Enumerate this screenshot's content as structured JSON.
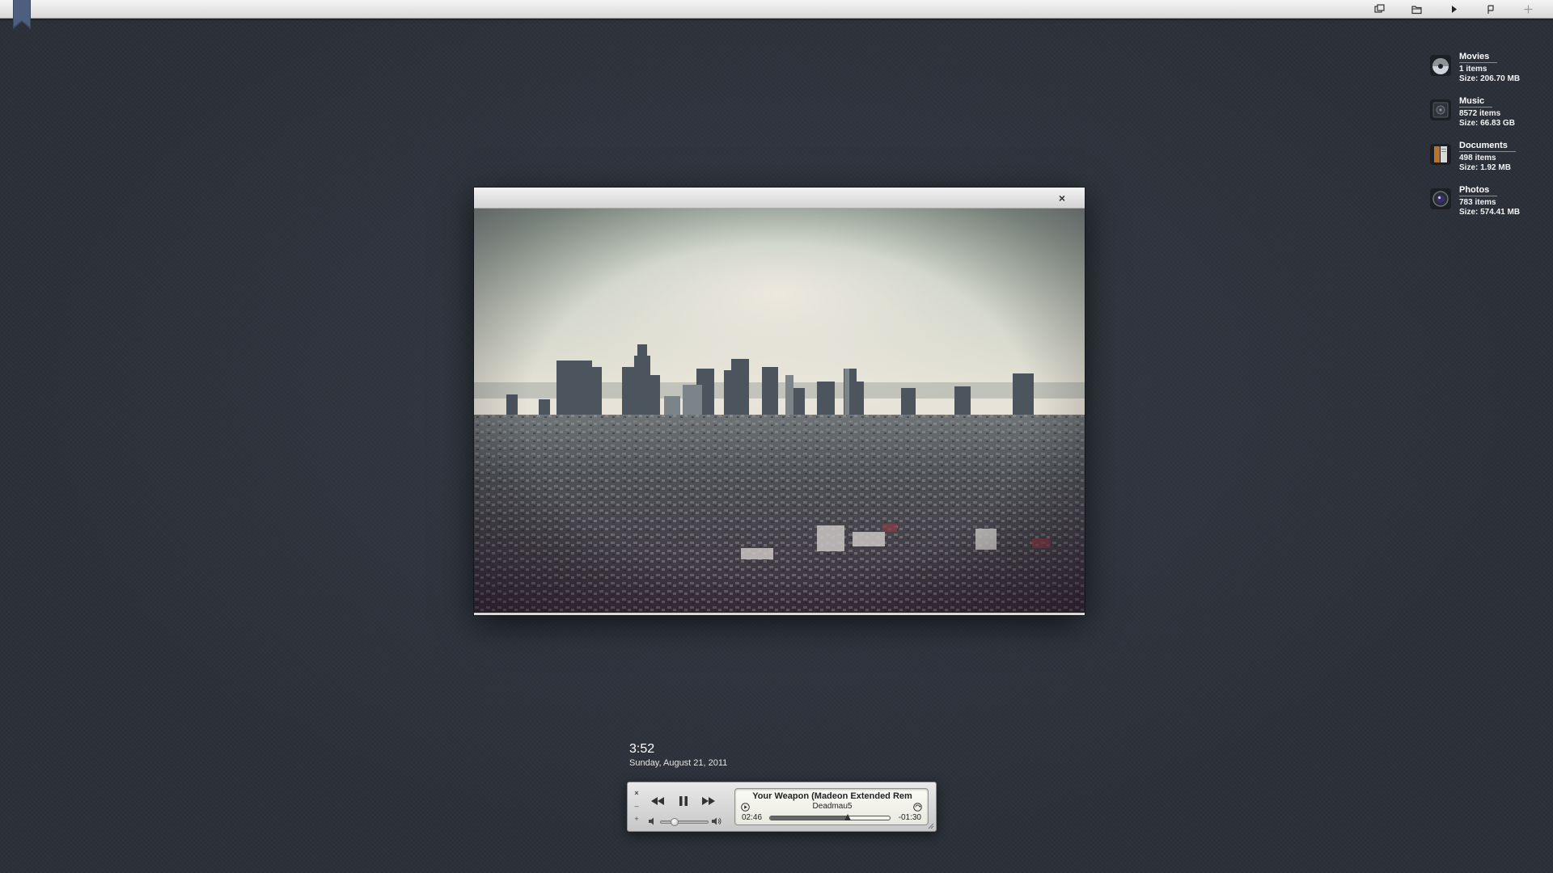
{
  "topbar": {
    "icons": [
      {
        "name": "windows-icon"
      },
      {
        "name": "folder-icon"
      },
      {
        "name": "play-icon"
      },
      {
        "name": "flag-icon"
      },
      {
        "name": "plus-icon"
      }
    ]
  },
  "shortcuts": [
    {
      "title": "Movies",
      "items": "1 items",
      "size": "Size: 206.70 MB",
      "icon": "movies-icon"
    },
    {
      "title": "Music",
      "items": "8572 items",
      "size": "Size: 66.83 GB",
      "icon": "music-icon"
    },
    {
      "title": "Documents",
      "items": "498 items",
      "size": "Size: 1.92 MB",
      "icon": "documents-icon"
    },
    {
      "title": "Photos",
      "items": "783 items",
      "size": "Size: 574.41 MB",
      "icon": "photos-icon"
    }
  ],
  "photo_window": {
    "close_label": "×"
  },
  "clock": {
    "time": "3:52",
    "date": "Sunday, August 21, 2011"
  },
  "player": {
    "close_label": "×",
    "minimize_label": "–",
    "zoom_label": "+",
    "track_title": "Your Weapon (Madeon Extended Rem",
    "artist": "Deadmau5",
    "elapsed": "02:46",
    "remaining": "-01:30",
    "progress": 0.65,
    "volume": 0.3
  }
}
